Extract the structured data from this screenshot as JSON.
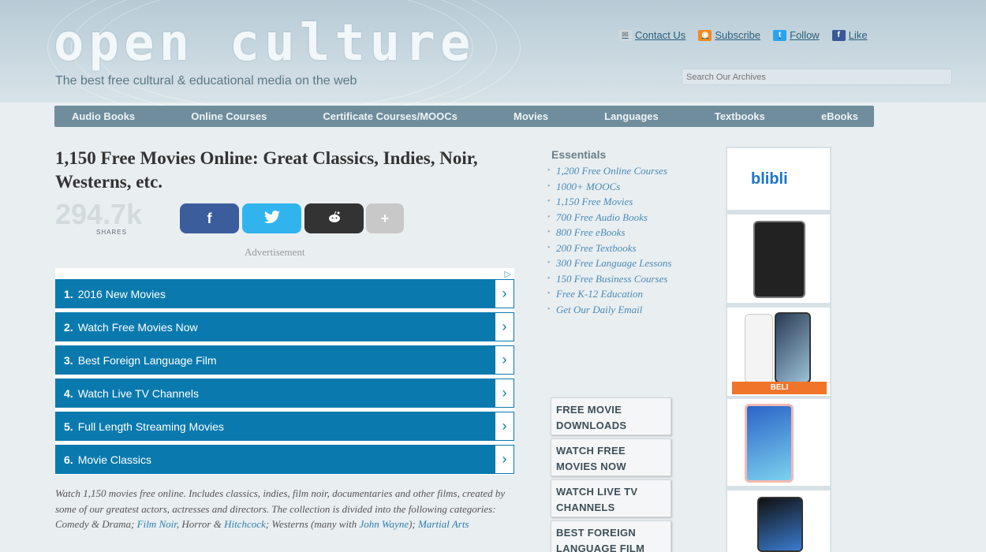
{
  "header": {
    "logo": "open culture",
    "tagline": "The best free cultural & educational media on the web",
    "social": [
      {
        "label": "Contact Us",
        "icon": "mail-icon",
        "color": "#c9d3d8"
      },
      {
        "label": "Subscribe",
        "icon": "rss-icon",
        "color": "#f08a24"
      },
      {
        "label": "Follow",
        "icon": "twitter-icon",
        "color": "#2aa3ef"
      },
      {
        "label": "Like",
        "icon": "facebook-icon",
        "color": "#3b5998"
      }
    ],
    "search_placeholder": "Search Our Archives"
  },
  "nav": [
    "Audio Books",
    "Online Courses",
    "Certificate Courses/MOOCs",
    "Movies",
    "Languages",
    "Textbooks",
    "eBooks"
  ],
  "article": {
    "title": "1,150 Free Movies Online: Great Classics, Indies, Noir, Westerns, etc.",
    "share_count": "294.7k",
    "share_label": "SHARES",
    "share_buttons": [
      {
        "label": "f",
        "icon": "facebook-icon",
        "color": "#3b5d9c"
      },
      {
        "label": "🐦",
        "icon": "twitter-icon",
        "color": "#31b4ee"
      },
      {
        "label": "👾",
        "icon": "reddit-icon",
        "color": "#333333"
      },
      {
        "label": "+",
        "icon": "plus-icon",
        "color": "#c8c8c8"
      }
    ],
    "ad_label": "Advertisement",
    "ad_items": [
      {
        "num": "1.",
        "label": "2016 New Movies"
      },
      {
        "num": "2.",
        "label": "Watch Free Movies Now"
      },
      {
        "num": "3.",
        "label": "Best Foreign Language Film"
      },
      {
        "num": "4.",
        "label": "Watch Live TV Channels"
      },
      {
        "num": "5.",
        "label": "Full Length Streaming Movies"
      },
      {
        "num": "6.",
        "label": "Movie Classics"
      }
    ],
    "body_pre": "Watch 1,150 movies free online. Includes classics, indies, film noir, documentaries and other films, created by some of our greatest actors, actresses and directors. The collection is divided into the following categories: Comedy & Drama; ",
    "body_link1": "Film Noir",
    "body_mid1": ", Horror & ",
    "body_link2": "Hitchcock",
    "body_mid2": "; Westerns (many with ",
    "body_link3": "John Wayne",
    "body_mid3": "); ",
    "body_link4": "Martial Arts"
  },
  "sidebar": {
    "heading": "Essentials",
    "items": [
      "1,200 Free Online Courses",
      "1000+ MOOCs",
      "1,150 Free Movies",
      "700 Free Audio Books",
      "800 Free eBooks",
      "200 Free Textbooks",
      "300 Free Language Lessons",
      "150 Free Business Courses",
      "Free K-12 Education",
      "Get Our Daily Email"
    ],
    "boxes": [
      "FREE MOVIE DOWNLOADS",
      "WATCH FREE MOVIES NOW",
      "WATCH LIVE TV CHANNELS",
      "BEST FOREIGN LANGUAGE FILM"
    ]
  },
  "right_ad": {
    "brand": "blibli",
    "cta": "BELI"
  }
}
